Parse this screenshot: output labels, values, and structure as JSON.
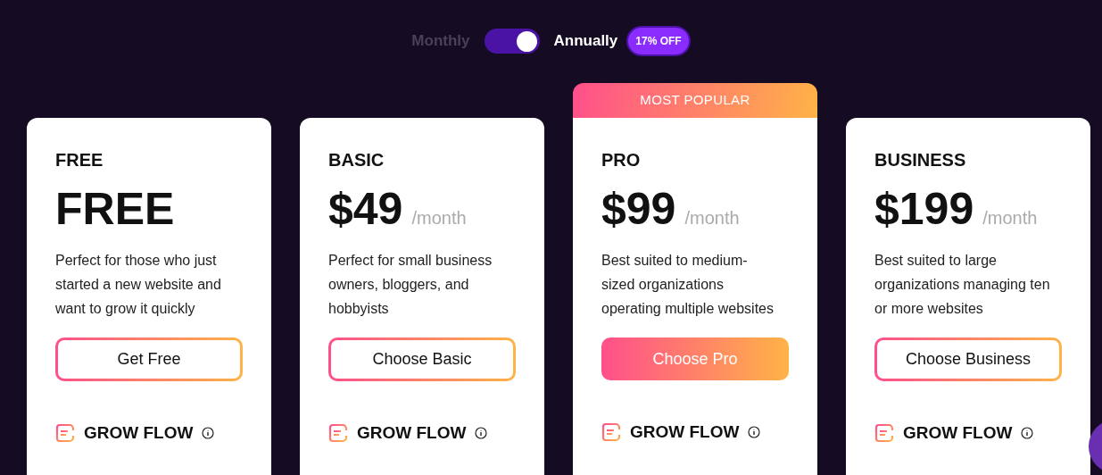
{
  "billing_toggle": {
    "left_label": "Monthly",
    "right_label": "Annually",
    "on": true,
    "discount_badge": "17% OFF"
  },
  "plans": [
    {
      "name": "FREE",
      "price": "FREE",
      "description": "Perfect for those who just started a new website and want to grow it quickly",
      "button": {
        "label": "Get Free",
        "kind": "outline"
      },
      "feature": "GROW FLOW"
    },
    {
      "name": "BASIC",
      "price": "$49",
      "period": "/month",
      "description": "Perfect for small business owners, bloggers, and hobbyists",
      "button": {
        "label": "Choose Basic",
        "kind": "outline"
      },
      "feature": "GROW FLOW"
    },
    {
      "name": "PRO",
      "price": "$99",
      "period": "/month",
      "ribbon": "MOST POPULAR",
      "description": "Best suited to medium-sized organizations operating multiple websites",
      "button": {
        "label": "Choose Pro",
        "kind": "filled"
      },
      "feature": "GROW FLOW"
    },
    {
      "name": "BUSINESS",
      "price": "$199",
      "period": "/month",
      "description": "Best suited to large organizations managing ten or more websites",
      "button": {
        "label": "Choose Business",
        "kind": "outline"
      },
      "feature": "GROW FLOW"
    }
  ]
}
